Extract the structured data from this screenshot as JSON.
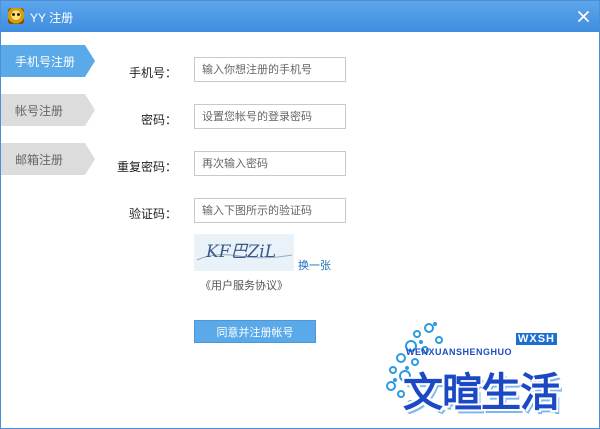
{
  "window": {
    "title": "YY 注册"
  },
  "sidebar": {
    "tabs": [
      {
        "label": "手机号注册",
        "active": true
      },
      {
        "label": "帐号注册",
        "active": false
      },
      {
        "label": "邮箱注册",
        "active": false
      }
    ]
  },
  "form": {
    "phone": {
      "label": "手机号：",
      "placeholder": "输入你想注册的手机号"
    },
    "password": {
      "label": "密码：",
      "placeholder": "设置您帐号的登录密码"
    },
    "confirm": {
      "label": "重复密码：",
      "placeholder": "再次输入密码"
    },
    "captcha": {
      "label": "验证码：",
      "placeholder": "输入下图所示的验证码",
      "image_text": "KF巴ZiL",
      "refresh_label": "换一张"
    },
    "agreement_label": "《用户服务协议》",
    "submit_label": "同意并注册帐号"
  },
  "watermark": {
    "badge": "WXSH",
    "pinyin": "WENXUANSHENGHUO",
    "chinese": "文暄生活"
  },
  "colors": {
    "titlebar": "#4a96e2",
    "accent": "#5aa9e8",
    "link": "#1a6fbf",
    "inactive_tab": "#dcdcdc"
  }
}
